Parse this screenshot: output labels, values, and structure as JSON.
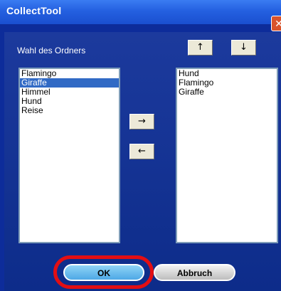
{
  "window": {
    "title": "CollectTool",
    "close_glyph": "✕"
  },
  "panel": {
    "folder_label": "Wahl des Ordners"
  },
  "buttons": {
    "up": "↑",
    "down": "↓",
    "move_right": "→",
    "move_left": "←",
    "ok": "OK",
    "cancel": "Abbruch"
  },
  "left_list": {
    "items": [
      "Flamingo",
      "Giraffe",
      "Himmel",
      "Hund",
      "Reise"
    ],
    "selected": "Giraffe"
  },
  "right_list": {
    "items": [
      "Hund",
      "Flamingo",
      "Giraffe"
    ]
  },
  "colors": {
    "title_bar": "#2460e0",
    "window_body": "#0d2c9a",
    "selection": "#316ac5",
    "highlight_ring": "#e30e13",
    "close_button": "#d9532c"
  }
}
